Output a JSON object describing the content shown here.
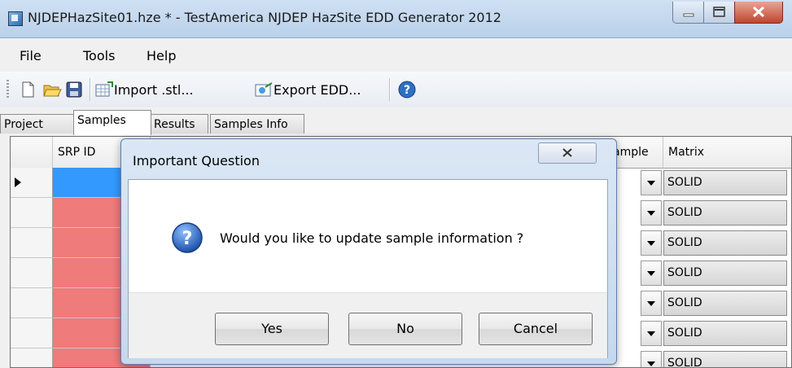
{
  "window": {
    "title": "NJDEPHazSite01.hze * - TestAmerica NJDEP HazSite EDD Generator 2012"
  },
  "menu": {
    "items": [
      "File",
      "Tools",
      "Help"
    ]
  },
  "toolbar": {
    "import_label": "Import .stl...",
    "export_label": "Export EDD..."
  },
  "tabs": [
    "Project",
    "Samples",
    "Results",
    "Samples Info"
  ],
  "grid": {
    "columns": {
      "srp_id": "SRP ID",
      "sample_partial": "ample",
      "matrix": "Matrix"
    },
    "rows": [
      {
        "matrix": "SOLID"
      },
      {
        "matrix": "SOLID"
      },
      {
        "matrix": "SOLID"
      },
      {
        "matrix": "SOLID"
      },
      {
        "matrix": "SOLID"
      },
      {
        "matrix": "SOLID"
      },
      {
        "matrix": "SOLID"
      }
    ]
  },
  "dialog": {
    "title": "Important Question",
    "message": "Would you like to update sample information ?",
    "buttons": {
      "yes": "Yes",
      "no": "No",
      "cancel": "Cancel"
    }
  },
  "colors": {
    "srp_cell_error": "#ef7b7b",
    "srp_cell_selected": "#3399ff"
  }
}
